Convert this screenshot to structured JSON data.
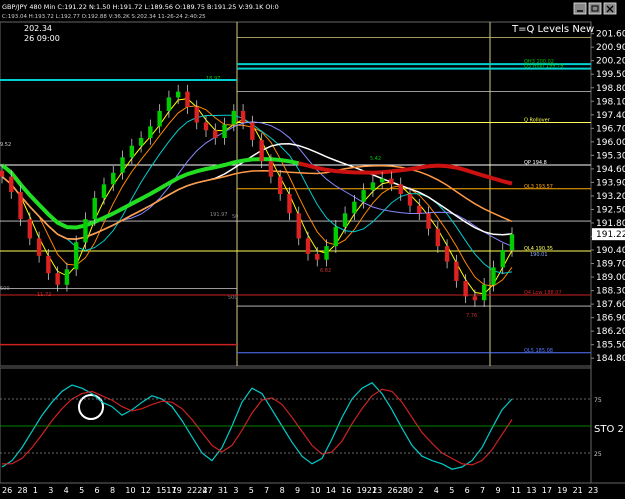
{
  "header": {
    "instrument_line": "GBP/JPY 480 Min  C:191.22 N:1.50 H:191.72 L:189.56 O:189.75 B:191.25 V:39.1K OI:0",
    "sub_line": "C:193.04 H:193.72 L:192.77 O:192.88 V:36.2K S:202.34 11-26-24 2:40:25",
    "cursor_price": "202.34",
    "cursor_time": "26 09:00",
    "title": "T=Q Levels New"
  },
  "window_buttons": [
    "minimize",
    "restore",
    "close"
  ],
  "price_axis": {
    "labels": [
      "201.60",
      "200.90",
      "200.20",
      "199.50",
      "198.80",
      "198.10",
      "197.40",
      "196.70",
      "196.00",
      "195.30",
      "194.60",
      "193.90",
      "193.20",
      "192.50",
      "191.80",
      "191.10",
      "190.40",
      "189.70",
      "189.00",
      "188.30",
      "187.60",
      "186.90",
      "186.20",
      "185.50",
      "184.80"
    ],
    "current_label": "191.22",
    "current_value": 191.22
  },
  "levels": [
    {
      "label": "QH3 200.02",
      "value": 200.02,
      "color": "#00d0d0",
      "label_color": "#00c000"
    },
    {
      "label": "Q3 High 199.79",
      "value": 199.79,
      "color": "#00d0d0",
      "label_color": "#00c000"
    },
    {
      "label": "Q Rollover",
      "value": 197.0,
      "color": "#ffff55",
      "label_color": "#ffff55"
    },
    {
      "label": "QP 194.8",
      "value": 194.8,
      "color": "#ffffff",
      "label_color": "#ffffff"
    },
    {
      "label": "QL3 193.57",
      "value": 193.57,
      "color": "#ffaa00",
      "label_color": "#ffaa00"
    },
    {
      "label": "QL4 190.35",
      "value": 190.35,
      "color": "#ffff55",
      "label_color": "#ffff55"
    },
    {
      "label": "Q4 Low 188.07",
      "value": 188.07,
      "color": "#cc2222",
      "label_color": "#cc2222"
    },
    {
      "label": "QL5 185.08",
      "value": 185.08,
      "color": "#5577ff",
      "label_color": "#5577ff"
    }
  ],
  "level_fragments": [
    "191.97",
    "190.01"
  ],
  "price_annotations": [
    "18.97",
    "5.42",
    "6.82",
    "11.72",
    "7.76",
    "9.52"
  ],
  "grid_markers": [
    "50",
    "500",
    "500"
  ],
  "stochastic": {
    "label": "STO  2",
    "levels": [
      75,
      25
    ],
    "level_labels": [
      "75",
      "25"
    ]
  },
  "x_axis": {
    "labels": [
      "26",
      "28",
      "1",
      "3",
      "4",
      "5",
      "6",
      "8",
      "10",
      "12",
      "1517",
      "19",
      "2224",
      "27",
      "31",
      "3",
      "5",
      "7",
      "8",
      "9",
      "10",
      "14",
      "16",
      "1921",
      "23",
      "2628",
      "30",
      "2",
      "4",
      "5",
      "6",
      "7",
      "9",
      "11",
      "13",
      "17",
      "19",
      "21",
      "23"
    ]
  },
  "chart_data": [
    {
      "type": "line",
      "panel": "price",
      "instrument": "GBP/JPY",
      "timeframe": "480 Min",
      "ylim": [
        184.5,
        202.1
      ],
      "series": [
        {
          "name": "Close",
          "color": "#ffffff",
          "values": [
            194.2,
            193.4,
            192.0,
            191.0,
            190.1,
            189.2,
            188.6,
            189.4,
            190.8,
            192.0,
            193.1,
            193.8,
            194.4,
            195.2,
            195.8,
            196.2,
            196.8,
            197.6,
            198.3,
            198.6,
            197.8,
            197.0,
            196.6,
            196.2,
            196.9,
            197.6,
            197.0,
            196.1,
            195.0,
            194.2,
            193.3,
            192.3,
            191.0,
            190.2,
            189.9,
            190.6,
            191.6,
            192.3,
            192.9,
            193.5,
            193.9,
            194.1,
            193.8,
            193.3,
            192.7,
            192.3,
            191.5,
            190.6,
            189.8,
            188.8,
            188.0,
            187.8,
            188.6,
            189.5,
            190.4,
            191.22
          ]
        }
      ]
    },
    {
      "type": "line",
      "panel": "stochastic",
      "ylim": [
        0,
        100
      ],
      "series": [
        {
          "name": "",
          "color": "#00cccc",
          "values": [
            12,
            18,
            30,
            45,
            60,
            72,
            82,
            88,
            85,
            80,
            72,
            68,
            60,
            65,
            72,
            78,
            75,
            68,
            55,
            40,
            25,
            18,
            30,
            50,
            72,
            85,
            80,
            65,
            50,
            35,
            22,
            15,
            20,
            38,
            58,
            75,
            85,
            90,
            80,
            65,
            48,
            32,
            22,
            18,
            15,
            10,
            12,
            18,
            30,
            48,
            65,
            75
          ]
        },
        {
          "name": "",
          "color": "#cc2222",
          "values": [
            15,
            15,
            20,
            30,
            42,
            55,
            66,
            75,
            80,
            82,
            78,
            74,
            68,
            64,
            66,
            70,
            73,
            72,
            66,
            56,
            44,
            32,
            26,
            32,
            46,
            62,
            74,
            76,
            70,
            58,
            45,
            32,
            24,
            26,
            36,
            52,
            66,
            78,
            84,
            82,
            72,
            58,
            44,
            34,
            25,
            20,
            15,
            14,
            18,
            28,
            42,
            56
          ]
        }
      ]
    }
  ]
}
